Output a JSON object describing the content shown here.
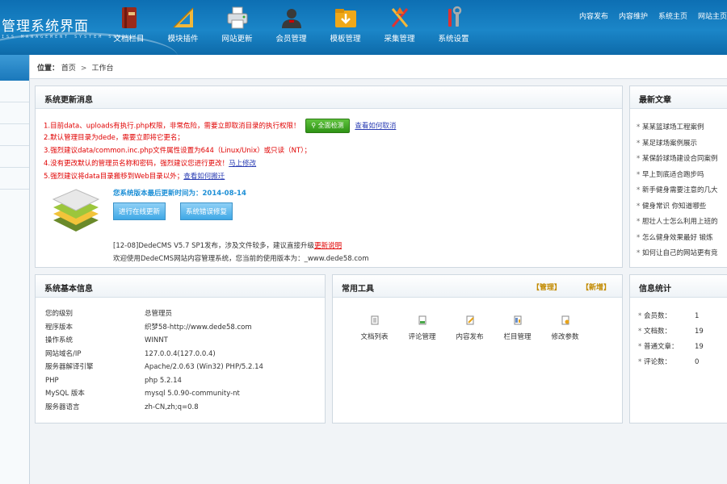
{
  "header": {
    "logo_title": "管理系统界面",
    "logo_sub": "ISS MANAGEMENT SYSTEM SSC",
    "nav": [
      {
        "label": "文档栏目",
        "icon": "book-icon"
      },
      {
        "label": "模块插件",
        "icon": "ruler-icon"
      },
      {
        "label": "网站更新",
        "icon": "printer-icon"
      },
      {
        "label": "会员管理",
        "icon": "user-icon"
      },
      {
        "label": "模板管理",
        "icon": "folder-download-icon"
      },
      {
        "label": "采集管理",
        "icon": "tools-icon"
      },
      {
        "label": "系统设置",
        "icon": "wrench-icon"
      }
    ],
    "links": [
      "内容发布",
      "内容维护",
      "系统主页",
      "网站主页"
    ]
  },
  "breadcrumb": {
    "prefix": "位置：",
    "home": "首页",
    "current": "工作台",
    "sep": ">"
  },
  "news_panel": {
    "title": "系统更新消息",
    "messages": {
      "m1": "1.目前data、uploads有执行.php权限，非常危险，需要立即取消目录的执行权限！",
      "m1_button": "全面检测",
      "m1_link": "查看如何取消",
      "m2": "2.默认管理目录为dede，需要立即将它更名；",
      "m3": "3.强烈建议data/common.inc.php文件属性设置为644（Linux/Unix）或只读（NT）；",
      "m4": "4.没有更改默认的管理员名称和密码，强烈建议您进行更改！",
      "m4_link": "马上修改",
      "m5": "5.强烈建议将data目录搬移到Web目录以外；",
      "m5_link": "查看如何搬迁"
    },
    "update_time": "您系统版本最后更新时间为：2014-08-14",
    "btn_online": "进行在线更新",
    "btn_repair": "系统错误修复",
    "news1_text": "[12-08]DedeCMS V5.7 SP1发布，涉及文件较多，建议直接升级",
    "news1_link": "更新说明",
    "news2": "欢迎使用DedeCMS网站内容管理系统，您当前的使用版本为：_www.dede58.com"
  },
  "latest_panel": {
    "title": "最新文章",
    "items": [
      "某某篮球场工程案例",
      "某足球场案例展示",
      "某保龄球场建设合同案例",
      "早上到底适合跑步吗",
      "新手健身需要注意的几大",
      "健身常识 你知道哪些",
      "胆壮人士怎么利用上班的",
      "怎么健身效果最好 锻炼",
      "如何让自己的网站更有竞"
    ]
  },
  "info_panel": {
    "title": "系统基本信息",
    "rows": [
      {
        "k": "您的级别",
        "v": "总管理员"
      },
      {
        "k": "程序版本",
        "v": "织梦58-http://www.dede58.com"
      },
      {
        "k": "操作系统",
        "v": "WINNT"
      },
      {
        "k": "网站域名/IP",
        "v": "127.0.0.4(127.0.0.4)"
      },
      {
        "k": "服务器解译引擎",
        "v": "Apache/2.0.63 (Win32) PHP/5.2.14"
      },
      {
        "k": "PHP",
        "v": "php 5.2.14"
      },
      {
        "k": "MySQL 版本",
        "v": "mysql 5.0.90-community-nt"
      },
      {
        "k": "服务器语言",
        "v": "zh-CN,zh;q=0.8"
      }
    ]
  },
  "tools_panel": {
    "title": "常用工具",
    "manage": "【管理】",
    "add": "【新增】",
    "tools": [
      {
        "label": "文档列表",
        "icon": "document-icon"
      },
      {
        "label": "评论管理",
        "icon": "comment-icon"
      },
      {
        "label": "内容发布",
        "icon": "edit-icon"
      },
      {
        "label": "栏目管理",
        "icon": "column-icon"
      },
      {
        "label": "修改参数",
        "icon": "settings-doc-icon"
      }
    ]
  },
  "stats_panel": {
    "title": "信息统计",
    "rows": [
      {
        "k": "会员数：",
        "v": "1"
      },
      {
        "k": "文档数：",
        "v": "19"
      },
      {
        "k": "普通文章：",
        "v": "19"
      },
      {
        "k": "评论数：",
        "v": "0"
      }
    ]
  },
  "colors": {
    "header": "#1b86c8",
    "warning": "#e00000",
    "link": "#2a3cb3",
    "accent_blue": "#1d8fd6",
    "tool_link": "#c28a00"
  }
}
